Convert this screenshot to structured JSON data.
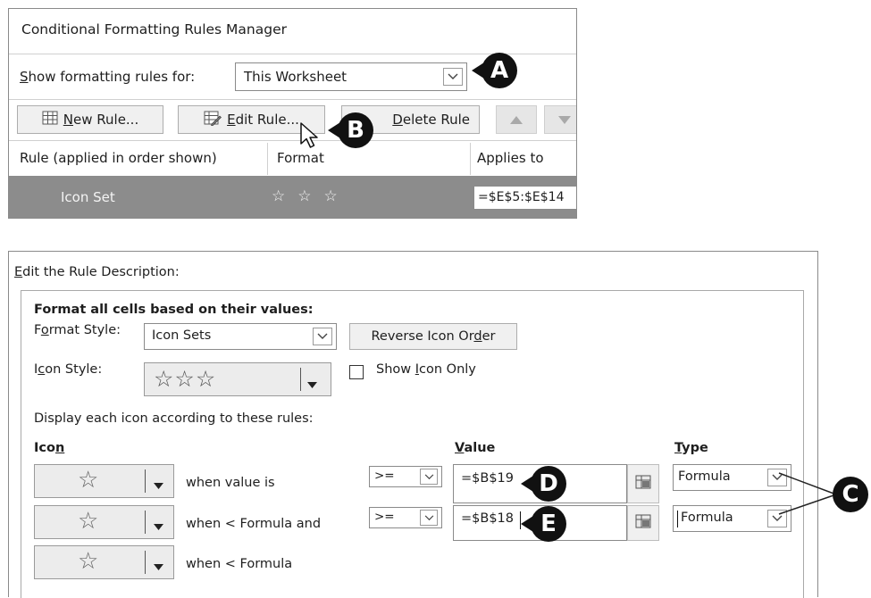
{
  "top_dialog": {
    "title": "Conditional Formatting Rules Manager",
    "show_rules_label": "Show formatting rules for:",
    "show_rules_accel": "S",
    "show_rules_rest": "how formatting rules for:",
    "show_rules_value": "This Worksheet",
    "new_rule_accel": "N",
    "new_rule_rest": "ew Rule...",
    "edit_rule_pre": "Edit Rule...",
    "edit_rule_accel": "E",
    "edit_rule_rest": "dit Rule...",
    "delete_rule_accel": "D",
    "delete_rule_rest": "elete Rule",
    "columns": [
      "Rule (applied in order shown)",
      "Format",
      "Applies to"
    ],
    "rule_row": {
      "rule": "Icon Set",
      "applies_to": "=$E$5:$E$14",
      "stars": [
        "☆",
        "☆",
        "☆"
      ]
    }
  },
  "edit_panel": {
    "header_accel": "E",
    "header_rest": "dit the Rule Description:",
    "section_title": "Format all cells based on their values:",
    "format_style_pre": "F",
    "format_style_accel": "o",
    "format_style_post": "rmat Style:",
    "format_style_value": "Icon Sets",
    "reverse_pre": "Reverse Icon Or",
    "reverse_accel": "d",
    "reverse_post": "er",
    "icon_style_pre": "I",
    "icon_style_accel": "c",
    "icon_style_post": "on Style:",
    "icon_style_stars": "☆☆☆",
    "show_icon_only_pre": "Show ",
    "show_icon_only_accel": "I",
    "show_icon_only_post": "con Only",
    "display_text": "Display each icon according to these rules:",
    "col_icon_pre": "Ico",
    "col_icon_accel": "n",
    "col_value_accel": "V",
    "col_value_rest": "alue",
    "col_type_accel": "T",
    "col_type_rest": "ype",
    "rules": [
      {
        "star": "☆",
        "when": "when value is",
        "op": ">=",
        "value": "=$B$19",
        "type": "Formula"
      },
      {
        "star": "☆",
        "when": "when < Formula and",
        "op": ">=",
        "value": "=$B$18",
        "type": "Formula"
      },
      {
        "star": "☆",
        "when": "when < Formula"
      }
    ]
  },
  "callouts": {
    "a": "A",
    "b": "B",
    "c": "C",
    "d": "D",
    "e": "E"
  }
}
